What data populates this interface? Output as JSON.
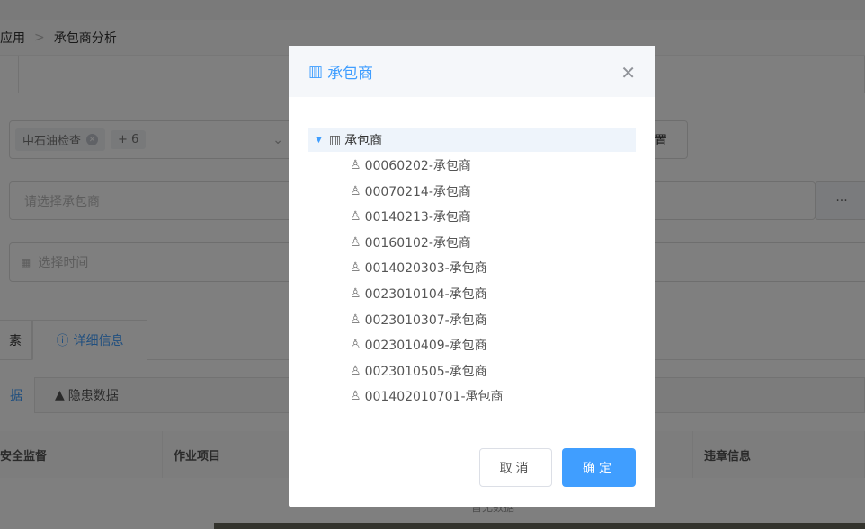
{
  "breadcrumb": {
    "parent": "应用",
    "current": "承包商分析"
  },
  "filters": {
    "category_tag": "中石油检查",
    "more_count": "+ 6",
    "reset_button": "置",
    "contractor_placeholder": "请选择承包商",
    "more_button": "···",
    "time_placeholder": "选择时间"
  },
  "tabs": [
    {
      "label": "素"
    },
    {
      "label": "详细信息",
      "active": true
    }
  ],
  "subtabs": [
    {
      "label": "据",
      "active": true
    },
    {
      "label": "隐患数据"
    }
  ],
  "table": {
    "columns": [
      "安全监督",
      "作业项目",
      "违章信息"
    ],
    "empty_text": "暂无数据"
  },
  "modal": {
    "title": "承包商",
    "tree": {
      "root": "承包商",
      "expanded": true,
      "children": [
        "00060202-承包商",
        "00070214-承包商",
        "00140213-承包商",
        "00160102-承包商",
        "0014020303-承包商",
        "0023010104-承包商",
        "0023010307-承包商",
        "0023010409-承包商",
        "0023010505-承包商",
        "001402010701-承包商"
      ]
    },
    "cancel": "取消",
    "confirm": "确定"
  },
  "colors": {
    "accent": "#409eff"
  }
}
